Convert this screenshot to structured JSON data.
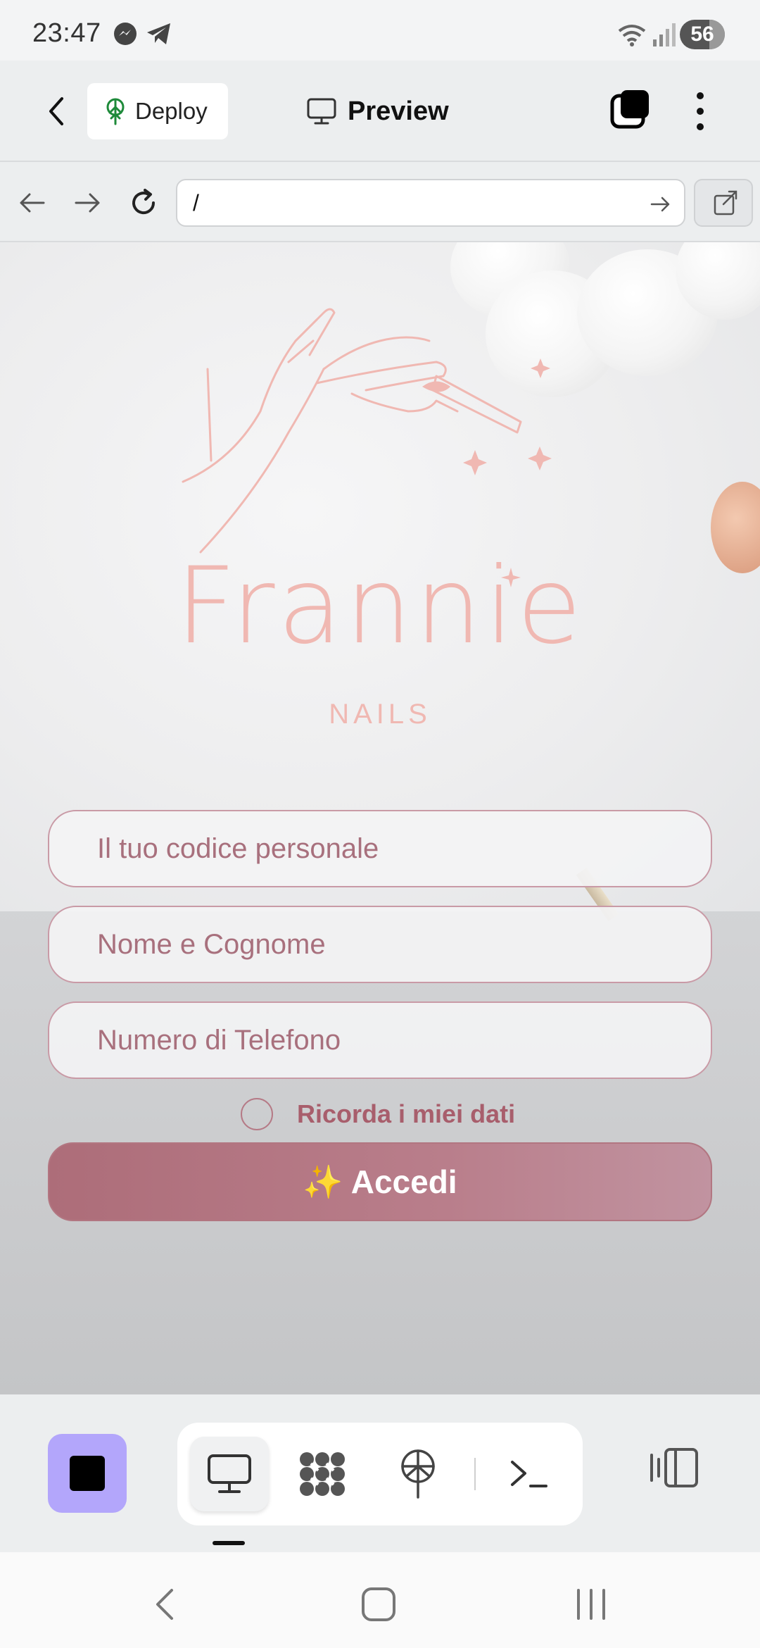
{
  "status_bar": {
    "time": "23:47",
    "battery": "56"
  },
  "app_bar": {
    "deploy_label": "Deploy",
    "title": "Preview"
  },
  "url_bar": {
    "url": "/"
  },
  "page": {
    "brand_name": "Frannie",
    "brand_sub": "NAILS",
    "fields": [
      {
        "placeholder": "Il tuo codice personale"
      },
      {
        "placeholder": "Nome e Cognome"
      },
      {
        "placeholder": "Numero di Telefono"
      }
    ],
    "remember_label": "Ricorda i miei dati",
    "login_label": "✨ Accedi"
  },
  "toolbar": {
    "items": [
      "desktop-preview",
      "components",
      "deploy",
      "terminal"
    ],
    "active": "desktop-preview"
  },
  "colors": {
    "accent": "#b3a6fb",
    "brand_pink": "#f0b8b2",
    "button": "#b27681",
    "field_border": "#c99aa6"
  }
}
